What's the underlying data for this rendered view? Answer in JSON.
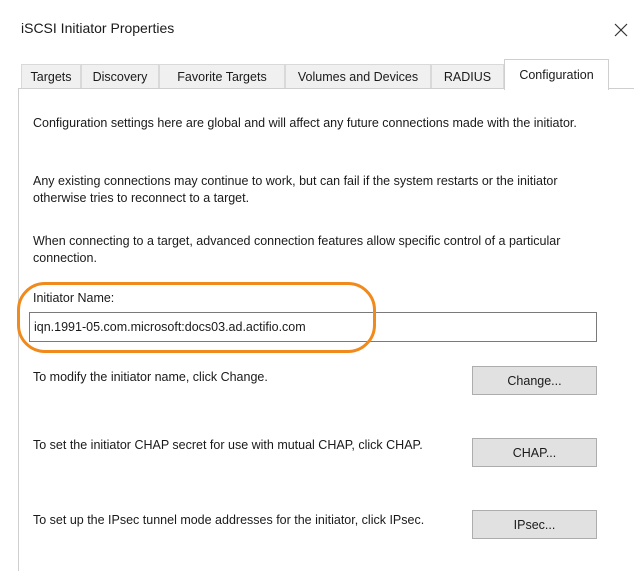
{
  "window": {
    "title": "iSCSI Initiator Properties",
    "close_glyph": "✕"
  },
  "tabs": [
    {
      "label": "Targets",
      "active": false
    },
    {
      "label": "Discovery",
      "active": false
    },
    {
      "label": "Favorite Targets",
      "active": false
    },
    {
      "label": "Volumes and Devices",
      "active": false
    },
    {
      "label": "RADIUS",
      "active": false
    },
    {
      "label": "Configuration",
      "active": true
    }
  ],
  "configuration": {
    "intro1": "Configuration settings here are global and will affect any future connections made with the initiator.",
    "intro2": "Any existing connections may continue to work, but can fail if the system restarts or the initiator otherwise tries to reconnect to a target.",
    "intro3": "When connecting to a target, advanced connection features allow specific control of a particular connection.",
    "initiator_name_label": "Initiator Name:",
    "initiator_name_value": "iqn.1991-05.com.microsoft:docs03.ad.actifio.com",
    "change_text": "To modify the initiator name, click Change.",
    "change_button": "Change...",
    "chap_text": "To set the initiator CHAP secret for use with mutual CHAP, click CHAP.",
    "chap_button": "CHAP...",
    "ipsec_text": "To set up the IPsec tunnel mode addresses for the initiator, click IPsec.",
    "ipsec_button": "IPsec..."
  },
  "colors": {
    "highlight": "#f08a1c",
    "button_bg": "#e1e1e1"
  },
  "icons": {
    "close": "close-icon"
  }
}
